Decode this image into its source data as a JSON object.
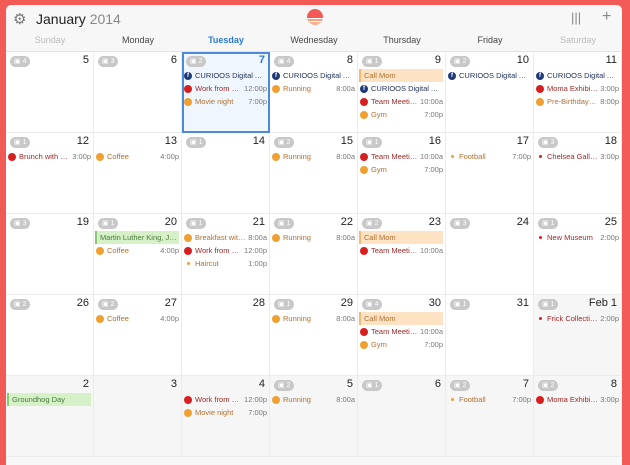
{
  "header": {
    "month": "January",
    "year": "2014",
    "settings_icon": "gear-icon",
    "view_icon": "columns-icon",
    "add_icon": "plus-icon"
  },
  "days_of_week": [
    "Sunday",
    "Monday",
    "Tuesday",
    "Wednesday",
    "Thursday",
    "Friday",
    "Saturday"
  ],
  "today_index": 2,
  "colors": {
    "background": "#f25b55",
    "today": "#2d7ad6",
    "facebook": "#1f3a7a",
    "red": "#d62020",
    "orange": "#f0a030"
  },
  "weeks": [
    [
      {
        "day": "5",
        "badge": "4",
        "events": []
      },
      {
        "day": "6",
        "badge": "3",
        "events": []
      },
      {
        "day": "7",
        "badge": "2",
        "today": true,
        "events": [
          {
            "kind": "facebook",
            "name": "CURIOOS Digital Art...",
            "time": ""
          },
          {
            "kind": "red",
            "name": "Work from ho...",
            "time": "12:00p"
          },
          {
            "kind": "orange",
            "name": "Movie night",
            "time": "7:00p"
          }
        ]
      },
      {
        "day": "8",
        "badge": "4",
        "events": [
          {
            "kind": "facebook",
            "name": "CURIOOS Digital Art...",
            "time": ""
          },
          {
            "kind": "orange",
            "name": "Running",
            "time": "8:00a"
          }
        ]
      },
      {
        "day": "9",
        "badge": "1",
        "events": [
          {
            "kind": "banner-orange",
            "name": "Call Mom",
            "time": ""
          },
          {
            "kind": "facebook",
            "name": "CURIOOS Digital Art...",
            "time": ""
          },
          {
            "kind": "red",
            "name": "Team Meeting",
            "time": "10:00a"
          },
          {
            "kind": "orange",
            "name": "Gym",
            "time": "7:00p"
          }
        ]
      },
      {
        "day": "10",
        "badge": "2",
        "events": [
          {
            "kind": "facebook",
            "name": "CURIOOS Digital Art...",
            "time": ""
          }
        ]
      },
      {
        "day": "11",
        "badge": "",
        "events": [
          {
            "kind": "facebook",
            "name": "CURIOOS Digital Art...",
            "time": ""
          },
          {
            "kind": "red",
            "name": "Moma Exhibition",
            "time": "3:00p"
          },
          {
            "kind": "orange",
            "name": "Pre-Birthday Di...",
            "time": "8:00p"
          }
        ]
      }
    ],
    [
      {
        "day": "12",
        "badge": "1",
        "events": [
          {
            "kind": "red",
            "name": "Brunch with Jer...",
            "time": "3:00p"
          }
        ]
      },
      {
        "day": "13",
        "badge": "",
        "events": [
          {
            "kind": "orange",
            "name": "Coffee",
            "time": "4:00p"
          }
        ]
      },
      {
        "day": "14",
        "badge": "1",
        "events": []
      },
      {
        "day": "15",
        "badge": "2",
        "events": [
          {
            "kind": "orange",
            "name": "Running",
            "time": "8:00a"
          }
        ]
      },
      {
        "day": "16",
        "badge": "1",
        "events": [
          {
            "kind": "red",
            "name": "Team Meeting",
            "time": "10:00a"
          },
          {
            "kind": "orange",
            "name": "Gym",
            "time": "7:00p"
          }
        ]
      },
      {
        "day": "17",
        "badge": "",
        "events": [
          {
            "kind": "dot-orange",
            "name": "Football",
            "time": "7:00p"
          }
        ]
      },
      {
        "day": "18",
        "badge": "3",
        "events": [
          {
            "kind": "dot-red",
            "name": "Chelsea Gallery",
            "time": "3:00p"
          }
        ]
      }
    ],
    [
      {
        "day": "19",
        "badge": "3",
        "events": []
      },
      {
        "day": "20",
        "badge": "1",
        "events": [
          {
            "kind": "banner-green",
            "name": "Martin Luther King, Jr's...",
            "time": ""
          },
          {
            "kind": "orange",
            "name": "Coffee",
            "time": "4:00p"
          }
        ]
      },
      {
        "day": "21",
        "badge": "1",
        "events": [
          {
            "kind": "orange",
            "name": "Breakfast with...",
            "time": "8:00a"
          },
          {
            "kind": "red",
            "name": "Work from ho...",
            "time": "12:00p"
          },
          {
            "kind": "dot-orange",
            "name": "Haircut",
            "time": "1:00p"
          }
        ]
      },
      {
        "day": "22",
        "badge": "1",
        "events": [
          {
            "kind": "orange",
            "name": "Running",
            "time": "8:00a"
          }
        ]
      },
      {
        "day": "23",
        "badge": "2",
        "events": [
          {
            "kind": "banner-orange",
            "name": "Call Mom",
            "time": ""
          },
          {
            "kind": "red",
            "name": "Team Meeting",
            "time": "10:00a"
          }
        ]
      },
      {
        "day": "24",
        "badge": "3",
        "events": []
      },
      {
        "day": "25",
        "badge": "1",
        "events": [
          {
            "kind": "dot-red",
            "name": "New Museum",
            "time": "2:00p"
          }
        ]
      }
    ],
    [
      {
        "day": "26",
        "badge": "2",
        "events": []
      },
      {
        "day": "27",
        "badge": "2",
        "events": [
          {
            "kind": "orange",
            "name": "Coffee",
            "time": "4:00p"
          }
        ]
      },
      {
        "day": "28",
        "badge": "",
        "events": []
      },
      {
        "day": "29",
        "badge": "1",
        "events": [
          {
            "kind": "orange",
            "name": "Running",
            "time": "8:00a"
          }
        ]
      },
      {
        "day": "30",
        "badge": "4",
        "events": [
          {
            "kind": "banner-orange",
            "name": "Call Mom",
            "time": ""
          },
          {
            "kind": "red",
            "name": "Team Meeting",
            "time": "10:00a"
          },
          {
            "kind": "orange",
            "name": "Gym",
            "time": "7:00p"
          }
        ]
      },
      {
        "day": "31",
        "badge": "1",
        "events": []
      },
      {
        "day": "Feb 1",
        "badge": "1",
        "other": true,
        "events": [
          {
            "kind": "dot-red",
            "name": "Frick Collection",
            "time": "2:00p"
          }
        ]
      }
    ],
    [
      {
        "day": "2",
        "badge": "",
        "other": true,
        "events": [
          {
            "kind": "banner-green",
            "name": "Groundhog Day",
            "time": ""
          }
        ]
      },
      {
        "day": "3",
        "badge": "",
        "other": true,
        "events": []
      },
      {
        "day": "4",
        "badge": "",
        "other": true,
        "events": [
          {
            "kind": "red",
            "name": "Work from ho...",
            "time": "12:00p"
          },
          {
            "kind": "orange",
            "name": "Movie night",
            "time": "7:00p"
          }
        ]
      },
      {
        "day": "5",
        "badge": "2",
        "other": true,
        "events": [
          {
            "kind": "orange",
            "name": "Running",
            "time": "8:00a"
          }
        ]
      },
      {
        "day": "6",
        "badge": "1",
        "other": true,
        "events": []
      },
      {
        "day": "7",
        "badge": "2",
        "other": true,
        "events": [
          {
            "kind": "dot-orange",
            "name": "Football",
            "time": "7:00p"
          }
        ]
      },
      {
        "day": "8",
        "badge": "2",
        "other": true,
        "events": [
          {
            "kind": "red",
            "name": "Moma Exhibition",
            "time": "3:00p"
          }
        ]
      }
    ]
  ]
}
